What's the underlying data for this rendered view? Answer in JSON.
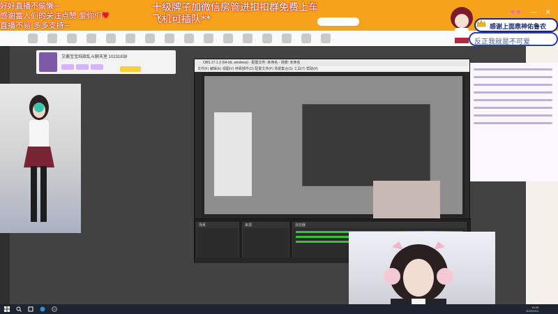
{
  "overlay": {
    "line1": "好好直播不偷懒~",
    "line2": "感谢富人们的关注点赞 爱你们",
    "line3": "直播不易 多多支持~",
    "line4": "十级牌子加微信房管进扣扣群免费上车",
    "line5": "飞机可插队**"
  },
  "badge": {
    "text": "感谢上面鼎神佑鲁农"
  },
  "bubble": {
    "text": "反正我就是不可爱"
  },
  "streamer": {
    "title": "艾酱宝宝纯欲乱斗聊天室 10231838"
  },
  "obs": {
    "title": "OBS 27.1.3 (64-bit, windows) - 配置文件: 未命名 - 场景: 未命名",
    "menu": "文件(F)  编辑(E)  视图(V)  停靠部件(D)  配置文件(P)  场景集合(S)  工具(T)  帮助(H)",
    "scenes_label": "场景",
    "sources_label": "来源",
    "mixer_label": "混音器"
  },
  "taskbar": {
    "time": "19:28",
    "date": "2022/1/14"
  },
  "window_controls": {
    "minimize": "—",
    "close": "✕"
  },
  "colors": {
    "site_orange": "#f7a21b",
    "overlay_red": "#c81e2c",
    "badge_blue": "#1b2a78",
    "obs_dark": "#2b2b2b"
  }
}
